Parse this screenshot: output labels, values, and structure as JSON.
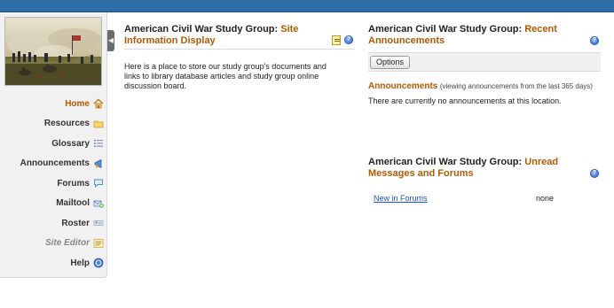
{
  "sidebar": {
    "items": [
      {
        "label": "Home",
        "icon": "home-icon",
        "active": true
      },
      {
        "label": "Resources",
        "icon": "folder-icon"
      },
      {
        "label": "Glossary",
        "icon": "list-icon"
      },
      {
        "label": "Announcements",
        "icon": "megaphone-icon"
      },
      {
        "label": "Forums",
        "icon": "speech-bubble-icon"
      },
      {
        "label": "Mailtool",
        "icon": "mail-icon"
      },
      {
        "label": "Roster",
        "icon": "roster-icon"
      },
      {
        "label": "Site Editor",
        "icon": "editor-icon"
      },
      {
        "label": "Help",
        "icon": "help-icon"
      }
    ]
  },
  "info_portlet": {
    "title_prefix": "American Civil War Study Group: ",
    "title_highlight": "Site Information Display",
    "body": "Here is a place to store our study group's documents and links to library database articles and study group online discussion board."
  },
  "announcements_portlet": {
    "title_prefix": "American Civil War Study Group: ",
    "title_highlight": "Recent Announcements",
    "options_label": "Options",
    "section_label": "Announcements",
    "section_note": "(viewing announcements from the last 365 days)",
    "empty_message": "There are currently no announcements at this location."
  },
  "unread_portlet": {
    "title_prefix": "American Civil War Study Group: ",
    "title_highlight": "Unread Messages and Forums",
    "row_link": "New in Forums",
    "row_value": "none"
  },
  "colors": {
    "accent": "#b35a00",
    "topbar": "#2f6fa8",
    "link": "#1a4fd6"
  }
}
